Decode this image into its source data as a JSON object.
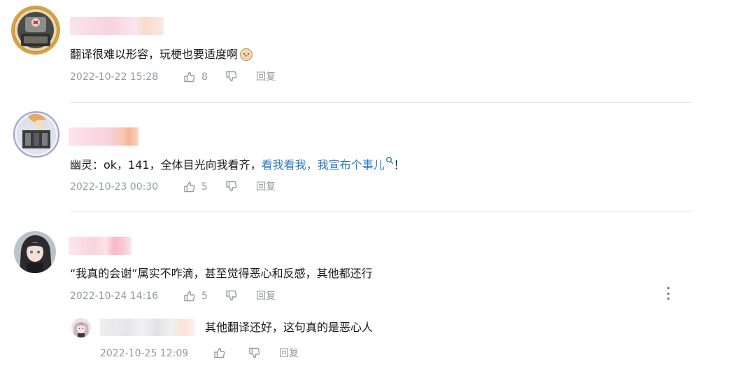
{
  "comments": [
    {
      "text": "翻译很难以形容，玩梗也要适度啊",
      "emoji": "doge-emoji",
      "time": "2022-10-22 15:28",
      "likes": "8",
      "reply": "回复"
    },
    {
      "text_prefix": "幽灵：ok，141，全体目光向我看齐，",
      "link_text": "看我看我，我宣布个事儿",
      "text_suffix": "！",
      "time": "2022-10-23 00:30",
      "likes": "5",
      "reply": "回复"
    },
    {
      "text": "“我真的会谢”属实不咋滴，甚至觉得恶心和反感，其他都还行",
      "time": "2022-10-24 14:16",
      "likes": "5",
      "reply": "回复",
      "sub_reply": {
        "text": "其他翻译还好，这句真的是恶心人",
        "time": "2022-10-25 12:09",
        "reply": "回复"
      }
    }
  ],
  "colors": {
    "link": "#2a7ac0",
    "meta": "#9499a0",
    "text": "#18191c",
    "divider": "#e3e5e7"
  }
}
